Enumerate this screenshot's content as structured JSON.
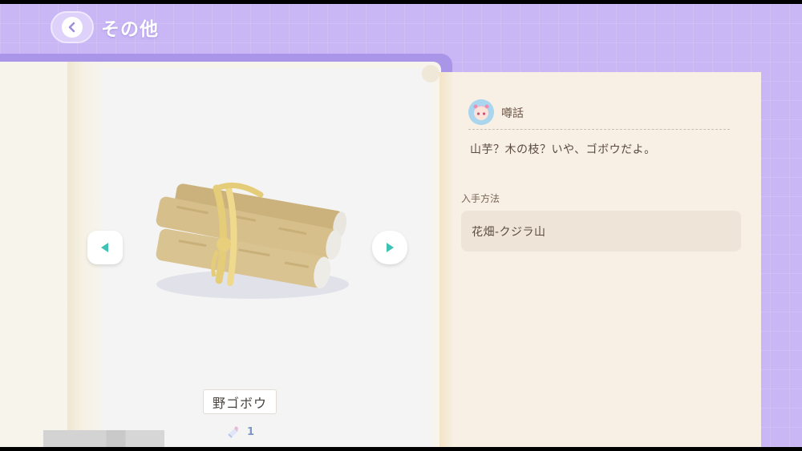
{
  "header": {
    "back_icon": "chevron-left-icon",
    "title": "その他"
  },
  "item": {
    "name": "野ゴボウ",
    "count": "1",
    "count_icon": "ribbon-gift-icon",
    "prev_icon": "triangle-left-icon",
    "next_icon": "triangle-right-icon"
  },
  "info": {
    "rumor_label": "噂話",
    "rumor_text": "山芋？木の枝？いや、ゴボウだよ。",
    "obtain_label": "入手方法",
    "obtain_value": "花畑-クジラ山"
  },
  "colors": {
    "background": "#c8b6f5",
    "accent_teal": "#3ec2b3",
    "page": "#f8f0e5",
    "text_brown": "#5b4a3e"
  }
}
